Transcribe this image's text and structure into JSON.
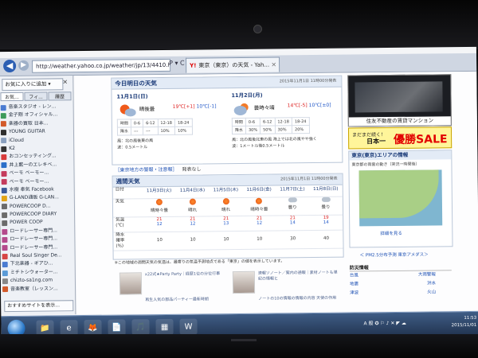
{
  "browser": {
    "url": "http://weather.yahoo.co.jp/weather/jp/13/4410.html",
    "url_controls": "P ▾ C ×",
    "tab_title": "東京（東京）の天気 - Yah...",
    "tab_brand": "Y!",
    "back_glyph": "◀",
    "forward_glyph": "▶"
  },
  "sidebar": {
    "add_favorites_label": "お気に入りに追加 ▾",
    "close_glyph": "×",
    "tabs": [
      "お気...",
      "フィ...",
      "履歴"
    ],
    "items": [
      {
        "label": "音楽スタジオ - レン...",
        "color": "#4a7bd1"
      },
      {
        "label": "金子剛 オフィシャル...",
        "color": "#3d9a5a"
      },
      {
        "label": "楽器の買取 日本...",
        "color": "#d25a2a"
      },
      {
        "label": "YOUNG GUITAR",
        "color": "#2f2f2f"
      },
      {
        "label": "iCloud",
        "color": "#8aa0bf"
      },
      {
        "label": "K2",
        "color": "#333333"
      },
      {
        "label": "おコンセッティング...",
        "color": "#d83b3b"
      },
      {
        "label": "井上藍一のエレキベ...",
        "color": "#2a6fc9"
      },
      {
        "label": "ベーモ ベーモー...",
        "color": "#c43c5d"
      },
      {
        "label": "ベーモ ベーモー...",
        "color": "#c43c5d"
      },
      {
        "label": "水樹 奉気 Facebook",
        "color": "#3b5998"
      },
      {
        "label": "G-LAND通販 G-LAN...",
        "color": "#e3a417"
      },
      {
        "label": "POWERCOOP D...",
        "color": "#6b6b6b"
      },
      {
        "label": "POWERCOOP DIARY",
        "color": "#6b6b6b"
      },
      {
        "label": "POWER COOP",
        "color": "#6b6b6b"
      },
      {
        "label": "ロードレーサー専門...",
        "color": "#b44a8c"
      },
      {
        "label": "ロードレーサー専門...",
        "color": "#b44a8c"
      },
      {
        "label": "ロードレーサー専門...",
        "color": "#b44a8c"
      },
      {
        "label": "Real Soul Singer De...",
        "color": "#d64545"
      },
      {
        "label": "下北楽器 - ギアひ...",
        "color": "#4a7bd1"
      },
      {
        "label": "ミチトシウォーター...",
        "color": "#5a9ad6"
      },
      {
        "label": "chizto-sa1ng.com",
        "color": "#888888"
      },
      {
        "label": "音楽教室（レッスン...",
        "color": "#d25a2a"
      }
    ],
    "bottom_label": "おすすめサイトを表示..."
  },
  "today_panel": {
    "title": "今日明日の天気",
    "timestamp": "2015年11月1日 11時00分発表",
    "days": [
      {
        "date": "11月1日(日)",
        "desc": "晴後曇",
        "high": "19℃[+1]",
        "low": "10℃[-1]",
        "table": [
          [
            "時間",
            "0-6",
            "6-12",
            "12-18",
            "18-24"
          ],
          [
            "降水",
            "---",
            "---",
            "10%",
            "10%"
          ]
        ],
        "wind": "風：北の風後東の風",
        "wave": "波：0.5メートル"
      },
      {
        "date": "11月2日(月)",
        "desc": "曇時々晴",
        "high": "14℃[-5]",
        "low": "10℃[±0]",
        "table": [
          [
            "時間",
            "0-6",
            "6-12",
            "12-18",
            "18-24"
          ],
          [
            "降水",
            "30%",
            "50%",
            "30%",
            "20%"
          ]
        ],
        "wind": "風：北の風後北東の風 海上では北の風やや強く",
        "wave": "波：1メートル後0.5メートル"
      }
    ]
  },
  "warning": {
    "link": "［東京地方の警報・注意報］",
    "status": "発表なし"
  },
  "week_panel": {
    "title": "週間天気",
    "timestamp": "2015年11月1日 11時00分発表",
    "dates": [
      "11月3日(火)",
      "11月4日(水)",
      "11月5日(木)",
      "11月6日(金)",
      "11月7日(土)",
      "11月8日(日)"
    ],
    "weather": [
      "晴時々曇",
      "晴れ",
      "晴れ",
      "晴時々曇",
      "曇り",
      "曇り"
    ],
    "icons": [
      "sun",
      "sun",
      "sun",
      "sun",
      "cloud",
      "cloud"
    ],
    "highs": [
      "21",
      "21",
      "21",
      "21",
      "21",
      "19"
    ],
    "lows": [
      "12",
      "12",
      "13",
      "12",
      "14",
      "14"
    ],
    "precip": [
      "10",
      "10",
      "10",
      "10",
      "30",
      "40"
    ],
    "labels": {
      "date": "日付",
      "weather": "天気",
      "temp": "気温\n(℃)",
      "precip": "降水\n確率\n(%)"
    }
  },
  "week_note": "※この地域の週間天気の気温は、最寄りの気温予測地点である「東京」の値を表示しています。",
  "news": [
    {
      "text": "x22式★Party Party｜経歴1位の分位行事"
    },
    {
      "text": "速報ソノート／案内の通報｜素材ノートも単紀の情報と"
    },
    {
      "text": "再生人気の部品パーティー最新時期"
    },
    {
      "text": "ノートの10の情報の情報の内容 天使の作用"
    }
  ],
  "ads": {
    "realestate_caption": "住友不動産の賃貸マンション",
    "sale_top": "まだまだ続く！",
    "sale_brand": "日本一",
    "sale_text": "優勝SALE"
  },
  "area_panel": {
    "title": "東京(東京)エリアの情報",
    "subtitle": "東京都の雨雲の動き（実況一時間後）",
    "more_link": "詳細を見る",
    "links": "＜ PM2.5分布予測 東京アメダス＞"
  },
  "tour": {
    "title": "防災情報",
    "rows": [
      [
        "台風",
        "大雨警報"
      ],
      [
        "地震",
        "洪水"
      ],
      [
        "津波",
        "火山"
      ]
    ]
  },
  "taskbar": {
    "buttons": [
      "📁",
      "e",
      "🦊",
      "📄",
      "🎵",
      "▦",
      "W"
    ],
    "tray": "A 般 ✪ ⚐ ♪ ✕ ◤ ☁",
    "time": "11:53",
    "date": "2015/11/01"
  },
  "colors": {
    "accent": "#1a3a78",
    "link": "#1b4fb3",
    "high": "#d22222",
    "low": "#2258c8",
    "sale": "#e20000"
  }
}
